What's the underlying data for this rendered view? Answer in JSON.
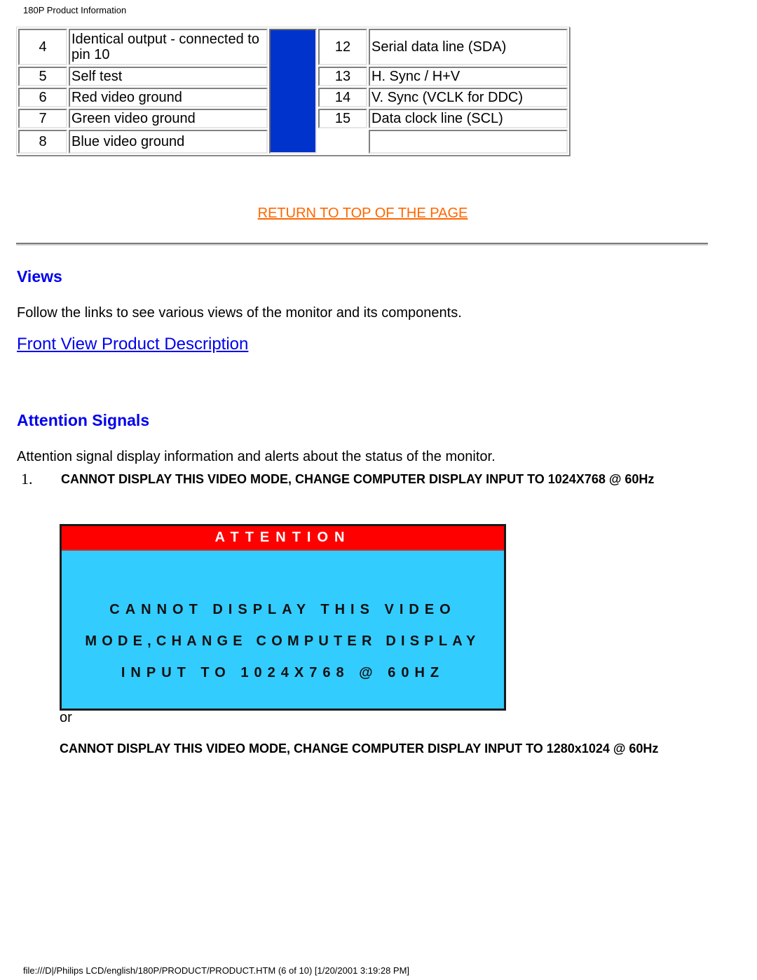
{
  "page": {
    "running_header": "180P Product Information",
    "footer": "file:///D|/Philips LCD/english/180P/PRODUCT/PRODUCT.HTM (6 of 10) [1/20/2001 3:19:28 PM]"
  },
  "pin_table": {
    "left_rows": [
      {
        "pin": "4",
        "signal": "Identical output - connected to pin 10"
      },
      {
        "pin": "5",
        "signal": "Self test"
      },
      {
        "pin": "6",
        "signal": "Red video ground"
      },
      {
        "pin": "7",
        "signal": "Green video ground"
      },
      {
        "pin": "8",
        "signal": "Blue video ground"
      }
    ],
    "right_rows": [
      {
        "pin": "12",
        "signal": "Serial data line (SDA)"
      },
      {
        "pin": "13",
        "signal": "H. Sync / H+V"
      },
      {
        "pin": "14",
        "signal": "V. Sync (VCLK for DDC)"
      },
      {
        "pin": "15",
        "signal": "Data clock line (SCL)"
      },
      {
        "pin": "",
        "signal": ""
      }
    ],
    "separator_color": "#0033cc"
  },
  "return_link": "RETURN TO TOP OF THE PAGE",
  "views": {
    "heading": "Views",
    "text": "Follow the links to see various views of the monitor and its components.",
    "link": "Front View Product Description"
  },
  "attention": {
    "heading": "Attention Signals",
    "text": "Attention signal display information and alerts about the status of the monitor.",
    "items": [
      {
        "number": "1.",
        "text": "CANNOT DISPLAY THIS VIDEO MODE, CHANGE COMPUTER DISPLAY INPUT TO 1024X768 @ 60Hz"
      }
    ],
    "osd": {
      "title": "ATTENTION",
      "lines": [
        "CANNOT DISPLAY THIS VIDEO",
        "MODE,CHANGE COMPUTER DISPLAY",
        "INPUT TO 1024X768 @ 60HZ"
      ],
      "title_bg": "#ff0000",
      "body_bg": "#33ccff"
    },
    "or_text": "or",
    "alt_text": "CANNOT DISPLAY THIS VIDEO MODE, CHANGE COMPUTER DISPLAY INPUT TO 1280x1024 @ 60Hz"
  },
  "colors": {
    "heading": "#0000ee",
    "link": "#0000ee",
    "return_link": "#ff6600"
  }
}
